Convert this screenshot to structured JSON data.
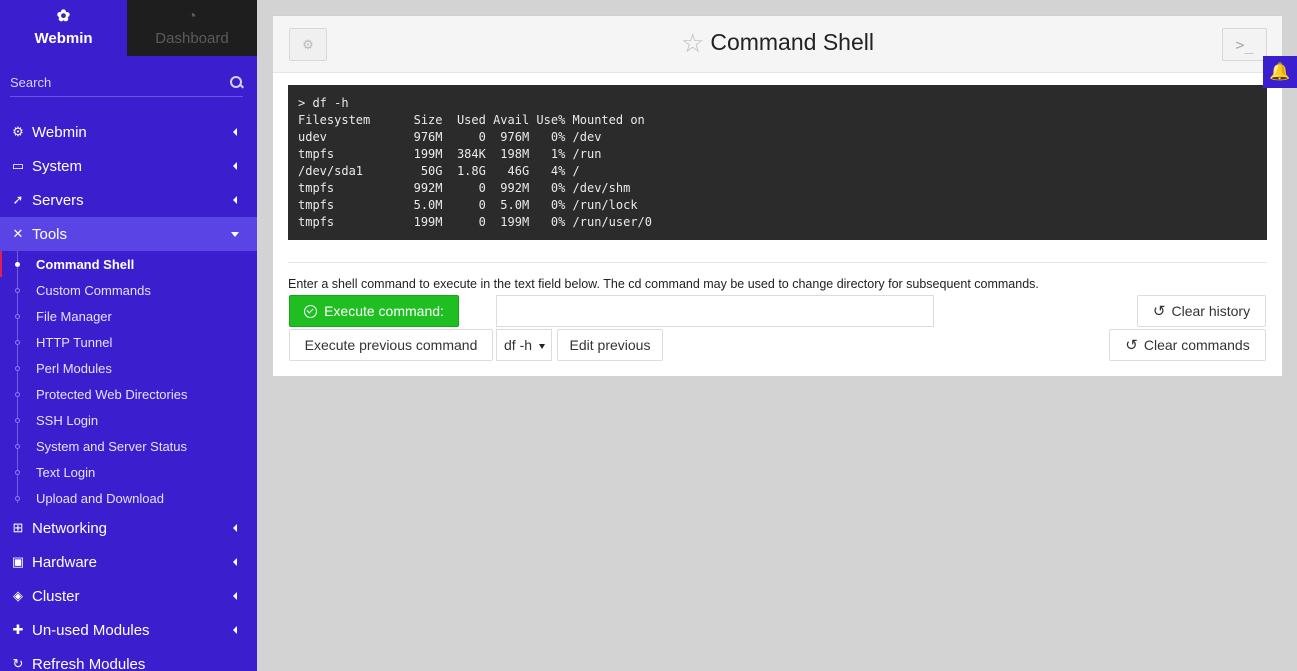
{
  "topnav": {
    "webmin": "Webmin",
    "dashboard": "Dashboard"
  },
  "search": {
    "placeholder": "Search"
  },
  "menu": [
    {
      "label": "Webmin",
      "icon": "gear-icon"
    },
    {
      "label": "System",
      "icon": "laptop-icon"
    },
    {
      "label": "Servers",
      "icon": "rocket-icon"
    },
    {
      "label": "Tools",
      "icon": "wrench-icon"
    }
  ],
  "tools_items": [
    "Command Shell",
    "Custom Commands",
    "File Manager",
    "HTTP Tunnel",
    "Perl Modules",
    "Protected Web Directories",
    "SSH Login",
    "System and Server Status",
    "Text Login",
    "Upload and Download"
  ],
  "menu_bottom": [
    {
      "label": "Networking",
      "icon": "network-icon"
    },
    {
      "label": "Hardware",
      "icon": "harddrive-icon"
    },
    {
      "label": "Cluster",
      "icon": "layers-icon"
    },
    {
      "label": "Un-used Modules",
      "icon": "puzzle-icon"
    },
    {
      "label": "Refresh Modules",
      "icon": "refresh-icon"
    }
  ],
  "page": {
    "title": "Command Shell"
  },
  "console": {
    "lines": [
      "> df -h",
      "Filesystem      Size  Used Avail Use% Mounted on",
      "udev            976M     0  976M   0% /dev",
      "tmpfs           199M  384K  198M   1% /run",
      "/dev/sda1        50G  1.8G   46G   4% /",
      "tmpfs           992M     0  992M   0% /dev/shm",
      "tmpfs           5.0M     0  5.0M   0% /run/lock",
      "tmpfs           199M     0  199M   0% /run/user/0"
    ]
  },
  "help_text": "Enter a shell command to execute in the text field below. The cd command may be used to change directory for subsequent commands.",
  "buttons": {
    "execute": "Execute command:",
    "execute_previous": "Execute previous command",
    "edit_previous": "Edit previous",
    "clear_history": "Clear history",
    "clear_commands": "Clear commands"
  },
  "command_input": {
    "value": ""
  },
  "previous_select": {
    "selected": "df -h"
  },
  "colors": {
    "sidebar": "#3b1fcf",
    "execute": "#1fbf22",
    "console_bg": "#2b2b2b"
  }
}
